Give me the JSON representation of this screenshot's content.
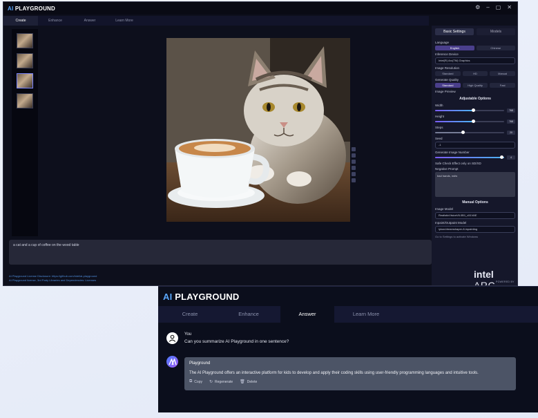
{
  "bg_window": {
    "logo": {
      "ai": "AI",
      "name": "PLAYGROUND"
    },
    "window_controls": [
      "⚙",
      "–",
      "▢",
      "✕"
    ],
    "tabs": [
      "Create",
      "Enhance",
      "Answer",
      "Learn More"
    ],
    "active_tab": "Create",
    "prompt_text": "a cat and a cup of coffee on the wood table",
    "footer_lines": [
      "AI Playground License Disclosure: https://github.com/intel/ai-playground",
      "AI Playground license, 3rd Party Libraries and Dependencies: Licenses"
    ],
    "panel": {
      "tabs": [
        "Basic Settings",
        "Models"
      ],
      "language_label": "Language",
      "language_options": [
        "English",
        "Chinese"
      ],
      "inference_label": "Inference Device",
      "inference_value": "Intel(R) Arc(TM) Graphics",
      "resolution_label": "Image Resolution",
      "resolution_options": [
        "Standard",
        "HD",
        "Manual"
      ],
      "quality_label": "Generate Quality",
      "quality_options": [
        "Standard",
        "High Quality",
        "Fast"
      ],
      "preview_label": "Image Preview",
      "adjustable_title": "Adjustable Options",
      "sliders": [
        {
          "label": "Width",
          "value": "768",
          "fraction": 0.55
        },
        {
          "label": "Height",
          "value": "768",
          "fraction": 0.55
        },
        {
          "label": "Steps",
          "value": "20",
          "fraction": 0.4
        },
        {
          "label": "Seed",
          "value": "-1",
          "fraction": null
        },
        {
          "label": "Generate Image Number",
          "value": "4",
          "fraction": 1.0
        }
      ],
      "safe_check_label": "Safe Check Effect only on SD/XD",
      "negative_label": "Negative Prompt",
      "negative_value": "bad hands, nsfw",
      "manual_title": "Manual Options",
      "image_model_label": "Image Model",
      "image_model_value": "RealisticVisionV6.0B1_v51VAE",
      "inpaint_label": "Inpaint/Outpaint Model",
      "inpaint_value": "lykon/dreamshaper-8-inpainting",
      "tooltip": "Go to Settings to activate Windows"
    },
    "brand": {
      "intel": "intel",
      "arc": "ARC",
      "powered": "POWERED BY"
    }
  },
  "fg_window": {
    "logo": {
      "ai": "AI",
      "name": "PLAYGROUND"
    },
    "tabs": [
      "Create",
      "Enhance",
      "Answer",
      "Learn More"
    ],
    "active_tab": "Answer",
    "user_message": {
      "name": "You",
      "text": "Can you summarize AI Playground in one sentence?"
    },
    "ai_message": {
      "name": "Playground",
      "text": "The AI Playground offers an interactive platform for kids to develop and apply their coding skills using user-friendly programming languages and intuitive tools.",
      "actions": [
        {
          "icon": "copy-icon",
          "label": "Copy"
        },
        {
          "icon": "regenerate-icon",
          "label": "Regenerate"
        },
        {
          "icon": "delete-icon",
          "label": "Delete"
        }
      ]
    }
  },
  "colors": {
    "accent": "#5aa8ff",
    "bubble": "#4c5466",
    "window_bg": "#0b0e1c"
  }
}
